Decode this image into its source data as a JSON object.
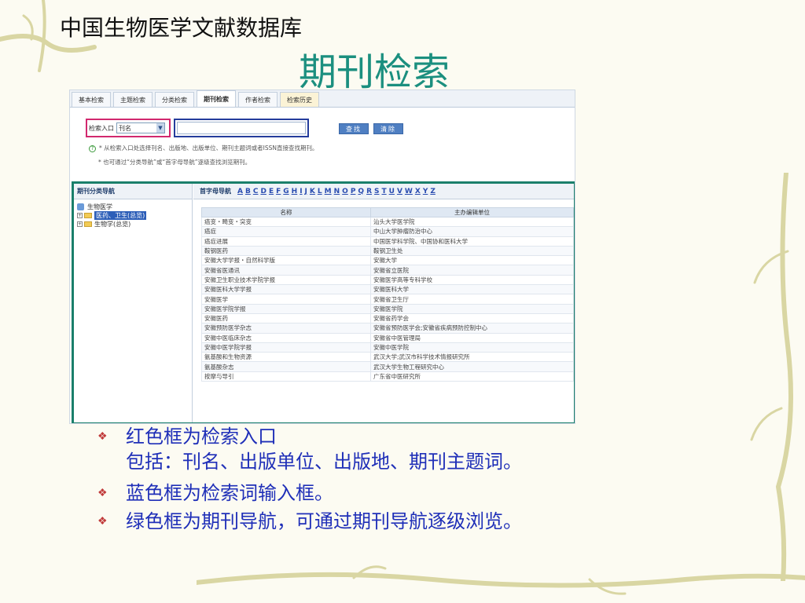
{
  "header": {
    "site_title": "中国生物医学文献数据库",
    "slide_title": "期刊检索"
  },
  "tabs": [
    {
      "label": "基本检索"
    },
    {
      "label": "主题检索"
    },
    {
      "label": "分类检索"
    },
    {
      "label": "期刊检索",
      "active": true
    },
    {
      "label": "作者检索"
    },
    {
      "label": "检索历史"
    }
  ],
  "search": {
    "entry_label": "检索入口",
    "field_value": "刊名",
    "input_value": "",
    "find_button": "查找",
    "clear_button": "清除",
    "hint1": "* 从检索入口处选择刊名、出版地、出版单位、期刊主题词或者ISSN直接查找期刊。",
    "hint2": "* 也可通过“分类导航”或“首字母导航”逐级查找浏览期刊。"
  },
  "nav": {
    "left_title": "期刊分类导航",
    "tree_root": "生物医学",
    "tree_child1": "医药、卫生(总览)",
    "tree_child2": "生物学(总览)",
    "alpha_title": "首字母导航",
    "letters": [
      "A",
      "B",
      "C",
      "D",
      "E",
      "F",
      "G",
      "H",
      "I",
      "J",
      "K",
      "L",
      "M",
      "N",
      "O",
      "P",
      "Q",
      "R",
      "S",
      "T",
      "U",
      "V",
      "W",
      "X",
      "Y",
      "Z"
    ]
  },
  "table": {
    "headers": [
      "名称",
      "主办编辑单位"
    ],
    "rows": [
      [
        "癌变・畸变・突变",
        "汕头大学医学院"
      ],
      [
        "癌症",
        "中山大学肿瘤防治中心"
      ],
      [
        "癌症进展",
        "中国医学科学院、中国协和医科大学"
      ],
      [
        "鞍钢医药",
        "鞍钢卫生处"
      ],
      [
        "安徽大学学报・自然科学版",
        "安徽大学"
      ],
      [
        "安徽省医通讯",
        "安徽省立医院"
      ],
      [
        "安徽卫生职业技术学院学报",
        "安徽医学高等专科学校"
      ],
      [
        "安徽医科大学学报",
        "安徽医科大学"
      ],
      [
        "安徽医学",
        "安徽省卫生厅"
      ],
      [
        "安徽医学院学报",
        "安徽医学院"
      ],
      [
        "安徽医药",
        "安徽省药学会"
      ],
      [
        "安徽预防医学杂志",
        "安徽省预防医学会;安徽省疾病预防控制中心"
      ],
      [
        "安徽中医临床杂志",
        "安徽省中医管理局"
      ],
      [
        "安徽中医学院学报",
        "安徽中医学院"
      ],
      [
        "氨基酸和生物资源",
        "武汉大学;武汉市科学技术情报研究所"
      ],
      [
        "氨基酸杂志",
        "武汉大学生物工程研究中心"
      ],
      [
        "按摩与导引",
        "广东省中医研究所"
      ]
    ]
  },
  "bullets": [
    {
      "line1": "红色框为检索入口",
      "line2": "包括：刊名、出版单位、出版地、期刊主题词。"
    },
    {
      "line1": "蓝色框为检索词输入框。"
    },
    {
      "line1": "绿色框为期刊导航，可通过期刊导航逐级浏览。"
    }
  ],
  "colors": {
    "slide_title": "#1b8f7f",
    "red_frame": "#d2286e",
    "blue_frame": "#243c9c",
    "green_frame": "#1a7f6b",
    "bullet_text": "#1f2fb8"
  }
}
